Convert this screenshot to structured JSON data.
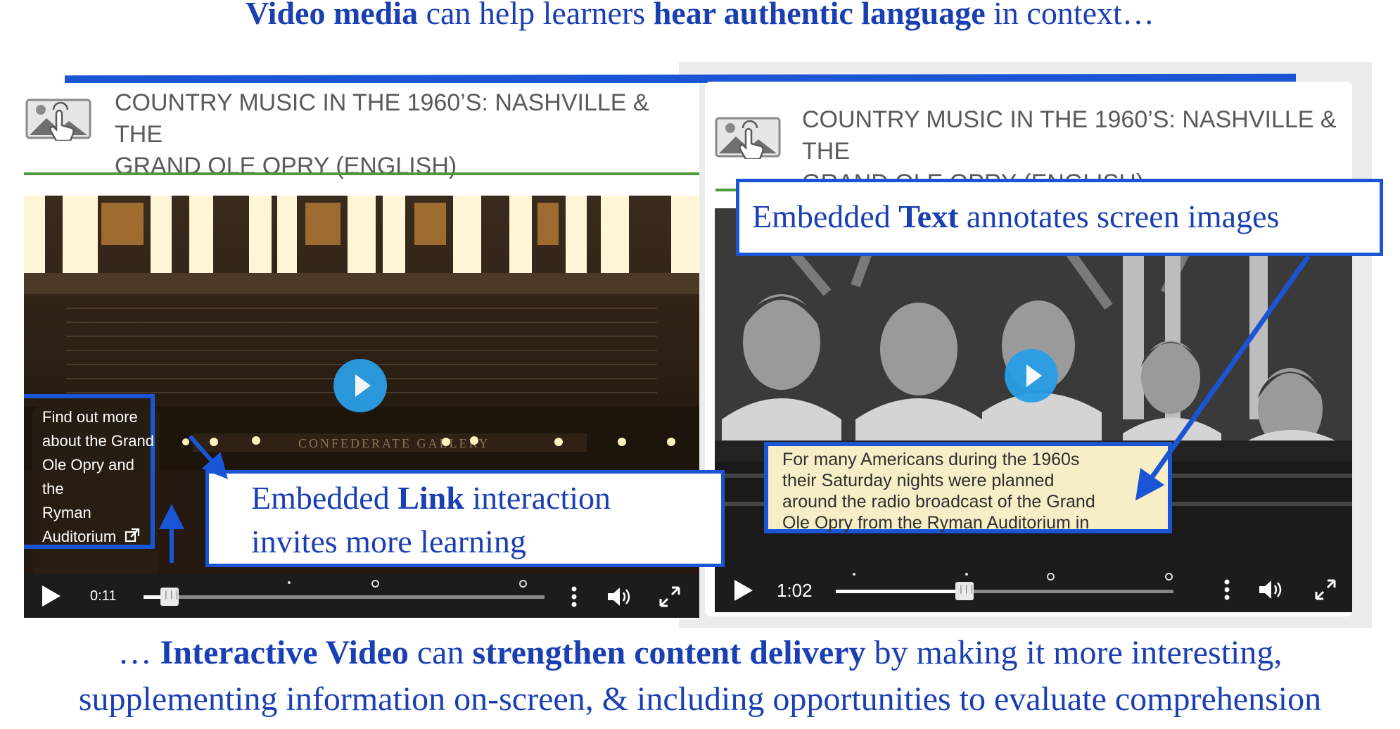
{
  "headline_top": {
    "a": "Video media",
    "b": " can help learners ",
    "c": "hear authentic language",
    "d": " in context…"
  },
  "headline_bottom": {
    "line1_a": "… ",
    "line1_b": "Interactive Video",
    "line1_c": " can ",
    "line1_d": "strengthen content delivery",
    "line1_e": " by making it more interesting,",
    "line2": "supplementing information on-screen, & including opportunities to evaluate comprehension"
  },
  "left_panel": {
    "title_line1": "COUNTRY MUSIC IN THE 1960’S: NASHVILLE & THE",
    "title_line2": "GRAND OLE OPRY (ENGLISH)",
    "balcony_sign": "CONFEDERATE GALLERY",
    "link_popup": [
      "Find out more",
      "about the Grand",
      "Ole Opry and the",
      "Ryman",
      "Auditorium"
    ],
    "time": "0:11",
    "progress": 0.06
  },
  "right_panel": {
    "title_line1": "COUNTRY MUSIC IN THE 1960’S: NASHVILLE & THE",
    "title_line2": "GRAND OLE OPRY (ENGLISH)",
    "caption": [
      "For many Americans during the 1960s",
      "their Saturday nights were planned",
      "around the radio broadcast of the Grand",
      "Ole Opry from the Ryman Auditorium in"
    ],
    "time": "1:02",
    "progress": 0.38
  },
  "callout_link": {
    "a": "Embedded ",
    "b": "Link",
    "c": " interaction",
    "line2": "invites more learning"
  },
  "callout_text": {
    "a": "Embedded ",
    "b": "Text",
    "c": " annotates screen images"
  },
  "colors": {
    "accent_blue": "#1a55d6",
    "text_blue": "#1a3fb3",
    "player_blue": "#2a9ee6",
    "green_rule": "#4c9a3a"
  }
}
